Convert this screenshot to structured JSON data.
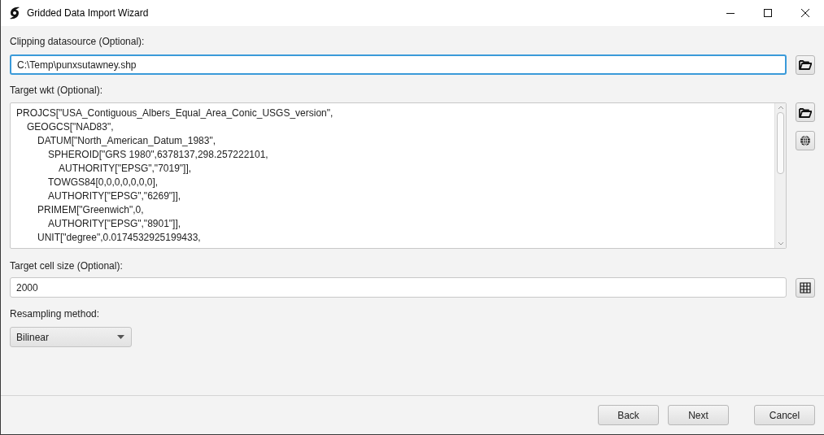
{
  "window": {
    "title": "Gridded Data Import Wizard"
  },
  "clipping": {
    "label": "Clipping datasource (Optional):",
    "value": "C:\\Temp\\punxsutawney.shp",
    "focused": true
  },
  "target_wkt": {
    "label": "Target wkt (Optional):",
    "lines": [
      {
        "text": "PROJCS[\"USA_Contiguous_Albers_Equal_Area_Conic_USGS_version\",",
        "children": [
          {
            "text": "GEOGCS[\"NAD83\",",
            "children": [
              {
                "text": "DATUM[\"North_American_Datum_1983\",",
                "children": [
                  {
                    "text": "SPHEROID[\"GRS 1980\",6378137,298.257222101,",
                    "children": [
                      {
                        "text": "AUTHORITY[\"EPSG\",\"7019\"]],"
                      }
                    ]
                  },
                  {
                    "text": "TOWGS84[0,0,0,0,0,0,0],"
                  },
                  {
                    "text": "AUTHORITY[\"EPSG\",\"6269\"]],"
                  }
                ]
              },
              {
                "text": "PRIMEM[\"Greenwich\",0,",
                "children": [
                  {
                    "text": "AUTHORITY[\"EPSG\",\"8901\"]],"
                  }
                ]
              },
              {
                "text": "UNIT[\"degree\",0.0174532925199433,"
              }
            ]
          }
        ]
      }
    ]
  },
  "cell_size": {
    "label": "Target cell size (Optional):",
    "value": "2000"
  },
  "resampling": {
    "label": "Resampling method:",
    "value": "Bilinear"
  },
  "buttons": [
    {
      "label": "Back",
      "kind": "back"
    },
    {
      "label": "Next",
      "kind": "next"
    },
    {
      "label": "Cancel",
      "kind": "cancel"
    }
  ]
}
